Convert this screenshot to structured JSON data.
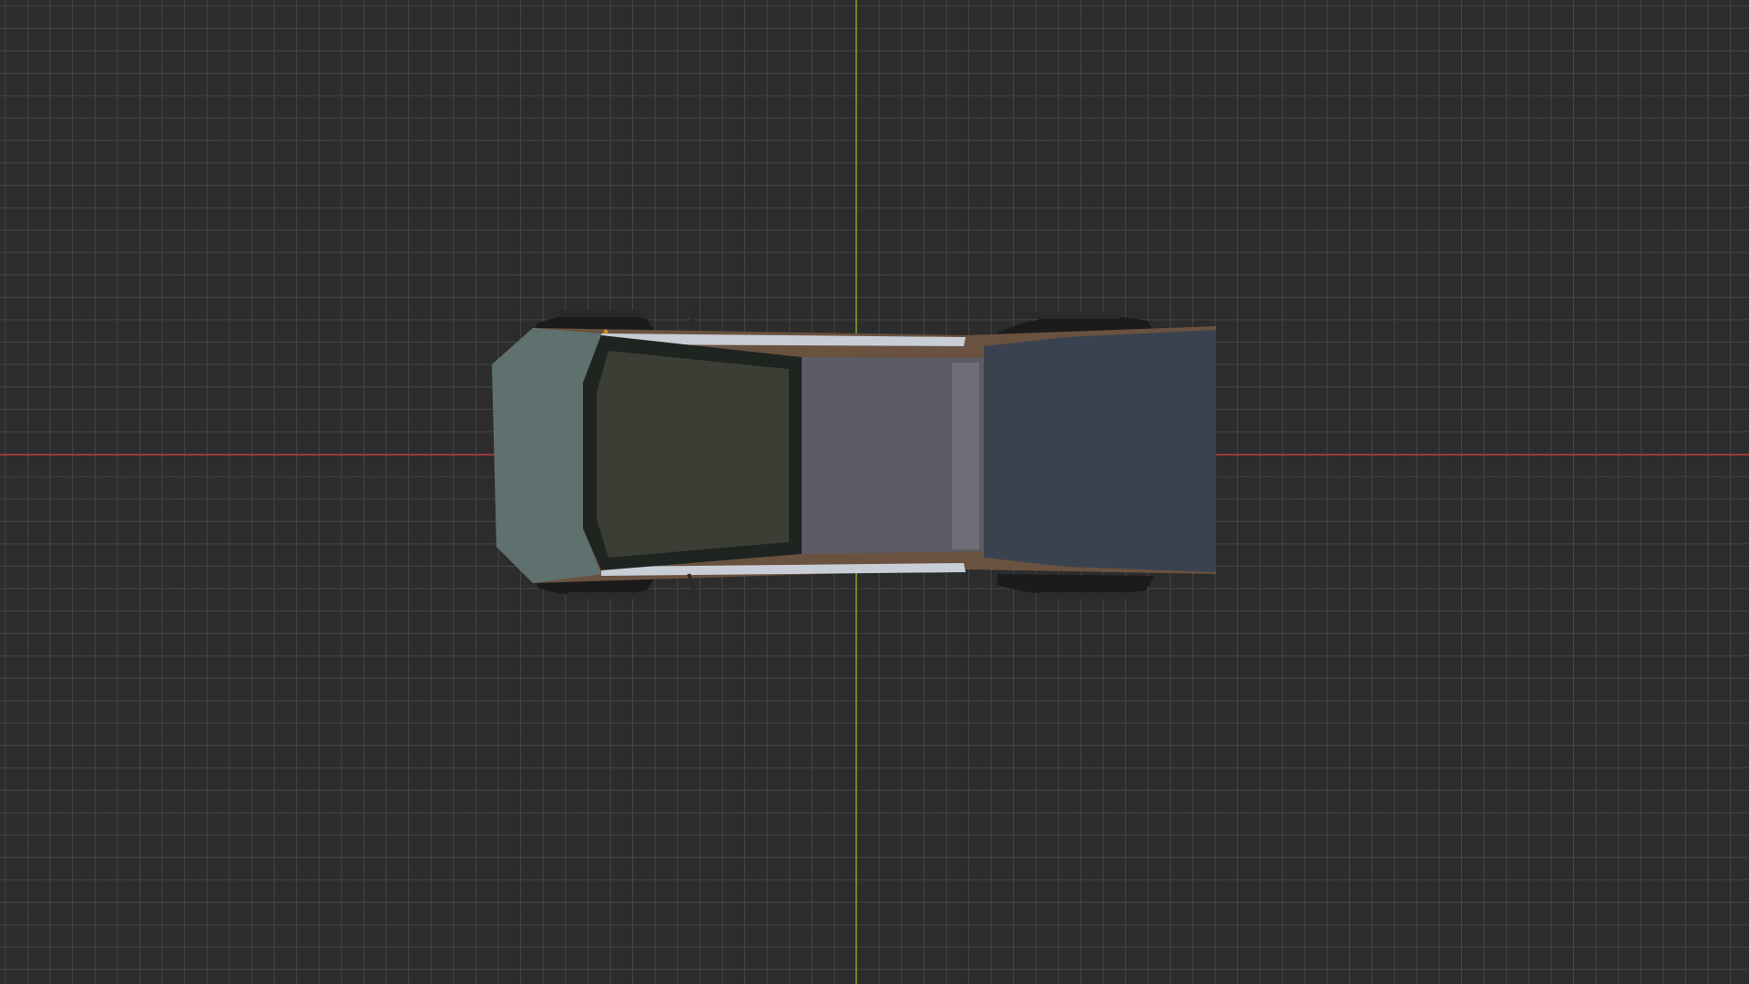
{
  "viewport": {
    "background_color": "#2c2c2c",
    "grid_color": "#5a5a5a",
    "x_axis_color": "#9a3a3a",
    "y_axis_color": "#6b8a2a"
  },
  "model": {
    "hood_color": "#5f716e",
    "windshield_color": "#3c3d35",
    "windshield_frame_color": "#1e2420",
    "roof_glass_color": "#5c5b66",
    "bed_cover_color": "#3a4250",
    "trim_color": "#c8cdd6",
    "tire_color": "#1b1b1c",
    "interior_color": "#6a5240"
  }
}
